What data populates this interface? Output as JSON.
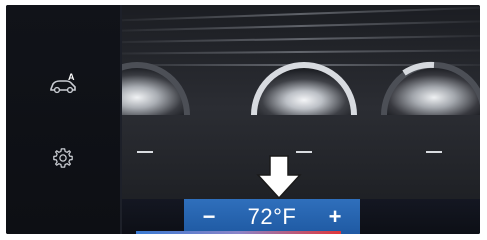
{
  "sidebar": {
    "items": [
      {
        "name": "auto-climate",
        "icon": "car-auto-icon",
        "label": "A"
      },
      {
        "name": "settings",
        "icon": "gear-icon"
      }
    ]
  },
  "climate": {
    "dials": [
      {
        "name": "left-vent-dial",
        "level": 0.15
      },
      {
        "name": "center-vent-dial",
        "level": 1.0
      },
      {
        "name": "right-vent-dial",
        "level": 0.1
      }
    ],
    "temperature": {
      "minus_label": "−",
      "value": "72°F",
      "plus_label": "+"
    }
  },
  "colors": {
    "accent_blue": "#2f6fbc",
    "hot_red": "#e0373a"
  }
}
